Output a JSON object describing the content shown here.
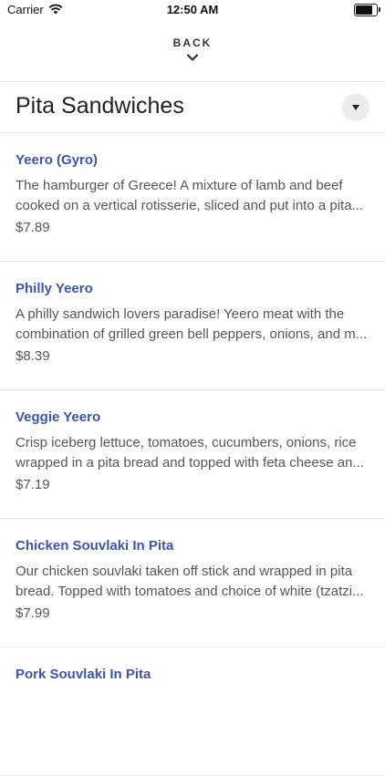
{
  "status_bar": {
    "carrier": "Carrier",
    "time": "12:50 AM",
    "wifi_icon": "wifi-icon",
    "battery_icon": "battery-icon"
  },
  "nav": {
    "back_label": "BACK",
    "back_icon": "chevron-down-icon"
  },
  "section": {
    "title": "Pita Sandwiches",
    "toggle_icon": "caret-down-icon"
  },
  "colors": {
    "item_name": "#3a54b4",
    "text": "#555555",
    "divider": "#e6e6e6"
  },
  "items": [
    {
      "name": "Yeero (Gyro)",
      "description": "The hamburger of Greece! A mixture of lamb and beef cooked on a vertical rotisserie, sliced and put into a pita...",
      "price": "$7.89"
    },
    {
      "name": "Philly Yeero",
      "description": "A philly sandwich lovers paradise! Yeero meat with the combination of grilled green bell peppers, onions, and m...",
      "price": "$8.39"
    },
    {
      "name": "Veggie Yeero",
      "description": "Crisp iceberg lettuce, tomatoes, cucumbers, onions, rice wrapped in a pita bread and topped with feta cheese an...",
      "price": "$7.19"
    },
    {
      "name": "Chicken Souvlaki In Pita",
      "description": "Our chicken souvlaki taken off stick and wrapped in pita bread. Topped with tomatoes and choice of white (tzatzi...",
      "price": "$7.99"
    },
    {
      "name": "Pork Souvlaki In Pita",
      "description": "",
      "price": ""
    }
  ]
}
